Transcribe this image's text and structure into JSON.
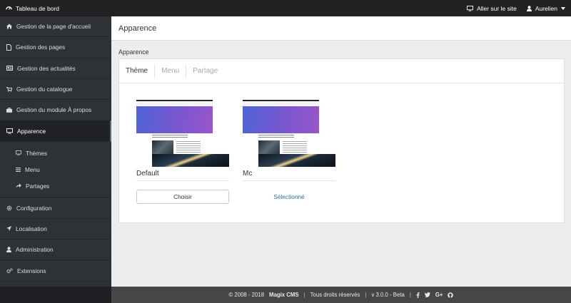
{
  "topbar": {
    "brand": "Tableau de bord",
    "site_link": "Aller sur le site",
    "user": "Aurelien"
  },
  "sidebar": {
    "items": [
      {
        "label": "Gestion de la page d'accueil",
        "icon": "home-icon"
      },
      {
        "label": "Gestion des pages",
        "icon": "file-icon"
      },
      {
        "label": "Gestion des actualités",
        "icon": "newspaper-icon"
      },
      {
        "label": "Gestion du catalogue",
        "icon": "cart-icon"
      },
      {
        "label": "Gestion du module À propos",
        "icon": "briefcase-icon"
      },
      {
        "label": "Apparence",
        "icon": "monitor-icon",
        "active": true
      },
      {
        "label": "Configuration",
        "icon": "gear-icon"
      },
      {
        "label": "Localisation",
        "icon": "location-arrow-icon"
      },
      {
        "label": "Administration",
        "icon": "user-icon"
      },
      {
        "label": "Extensions",
        "icon": "cogs-icon"
      }
    ],
    "subitems": [
      {
        "label": "Thèmes",
        "icon": "monitor-icon"
      },
      {
        "label": "Menu",
        "icon": "menu-icon"
      },
      {
        "label": "Partages",
        "icon": "share-icon"
      }
    ]
  },
  "main": {
    "page_title": "Apparence",
    "section_title": "Apparence",
    "tabs": [
      {
        "label": "Thème",
        "active": true
      },
      {
        "label": "Menu",
        "active": false
      },
      {
        "label": "Partage",
        "active": false
      }
    ],
    "themes": [
      {
        "name": "Default",
        "action": "Choisir"
      },
      {
        "name": "Mc",
        "action": "Sélectionné"
      }
    ]
  },
  "footer": {
    "copyright": "© 2008 - 2018",
    "product": "Magix CMS",
    "rights": "Tous droits réservés",
    "version": "v 3.0.0 - Beta",
    "social": [
      "facebook-icon",
      "twitter-icon",
      "google-plus-icon",
      "github-icon"
    ],
    "gplus_text": "G+"
  },
  "colors": {
    "topbar": "#222222",
    "sidebar": "#2e3136",
    "footer": "#464646",
    "link": "#2a6fb0"
  }
}
